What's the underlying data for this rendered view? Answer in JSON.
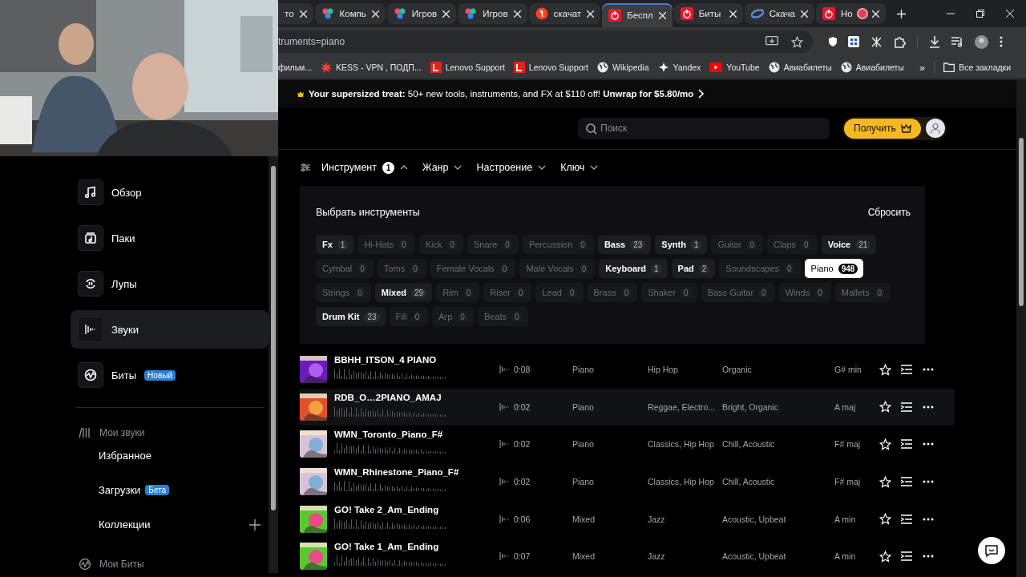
{
  "browser": {
    "tabs": [
      {
        "title": "то",
        "selected": false,
        "recording": false
      },
      {
        "title": "Компь",
        "selected": false,
        "recording": false
      },
      {
        "title": "Игров",
        "selected": false,
        "recording": false
      },
      {
        "title": "Игров",
        "selected": false,
        "recording": false
      },
      {
        "title": "скачат",
        "selected": false,
        "recording": false
      },
      {
        "title": "Беспл",
        "selected": true,
        "recording": false
      },
      {
        "title": "Биты",
        "selected": false,
        "recording": false
      },
      {
        "title": "Скача",
        "selected": false,
        "recording": false
      },
      {
        "title": "Но",
        "selected": false,
        "recording": true
      }
    ],
    "address": "truments=piano",
    "bookmarks": [
      {
        "label": "фильм..."
      },
      {
        "label": "KESS - VPN , ПОДП..."
      },
      {
        "label": "Lenovo Support"
      },
      {
        "label": "Lenovo Support"
      },
      {
        "label": "Wikipedia"
      },
      {
        "label": "Yandex"
      },
      {
        "label": "YouTube"
      },
      {
        "label": "Авиабилеты"
      },
      {
        "label": "Авиабилеты"
      }
    ],
    "more_bookmarks": "»",
    "all_bookmarks": "Все закладки"
  },
  "banner": {
    "text": "**Your supersized treat:** 50+ new tools, instruments, and FX at $110 off! **Unwrap for $5.80/mo**"
  },
  "header": {
    "search": {
      "placeholder": "Поиск"
    },
    "get_button": "Получить"
  },
  "filters": [
    {
      "label": "Инструмент",
      "badge": "1",
      "expanded": true
    },
    {
      "label": "Жанр",
      "expanded": false
    },
    {
      "label": "Настроение",
      "expanded": false
    },
    {
      "label": "Ключ",
      "expanded": false
    }
  ],
  "instrument_panel": {
    "title": "Выбрать инструменты",
    "reset": "Сбросить",
    "chips": [
      {
        "label": "Fx",
        "count": "1",
        "disabled": false,
        "selected": false
      },
      {
        "label": "Hi-Hats",
        "count": "0",
        "disabled": true,
        "selected": false
      },
      {
        "label": "Kick",
        "count": "0",
        "disabled": true,
        "selected": false
      },
      {
        "label": "Snare",
        "count": "0",
        "disabled": true,
        "selected": false
      },
      {
        "label": "Percussion",
        "count": "0",
        "disabled": true,
        "selected": false
      },
      {
        "label": "Bass",
        "count": "23",
        "disabled": false,
        "selected": false
      },
      {
        "label": "Synth",
        "count": "1",
        "disabled": false,
        "selected": false
      },
      {
        "label": "Guitar",
        "count": "0",
        "disabled": true,
        "selected": false
      },
      {
        "label": "Claps",
        "count": "0",
        "disabled": true,
        "selected": false
      },
      {
        "label": "Voice",
        "count": "21",
        "disabled": false,
        "selected": false
      },
      {
        "label": "Cymbal",
        "count": "0",
        "disabled": true,
        "selected": false
      },
      {
        "label": "Toms",
        "count": "0",
        "disabled": true,
        "selected": false
      },
      {
        "label": "Female Vocals",
        "count": "0",
        "disabled": true,
        "selected": false
      },
      {
        "label": "Male Vocals",
        "count": "0",
        "disabled": true,
        "selected": false
      },
      {
        "label": "Keyboard",
        "count": "1",
        "disabled": false,
        "selected": false
      },
      {
        "label": "Pad",
        "count": "2",
        "disabled": false,
        "selected": false
      },
      {
        "label": "Soundscapes",
        "count": "0",
        "disabled": true,
        "selected": false
      },
      {
        "label": "Piano",
        "count": "948",
        "disabled": false,
        "selected": true
      },
      {
        "label": "Strings",
        "count": "0",
        "disabled": true,
        "selected": false
      },
      {
        "label": "Mixed",
        "count": "29",
        "disabled": false,
        "selected": false
      },
      {
        "label": "Rim",
        "count": "0",
        "disabled": true,
        "selected": false
      },
      {
        "label": "Riser",
        "count": "0",
        "disabled": true,
        "selected": false
      },
      {
        "label": "Lead",
        "count": "0",
        "disabled": true,
        "selected": false
      },
      {
        "label": "Brass",
        "count": "0",
        "disabled": true,
        "selected": false
      },
      {
        "label": "Shaker",
        "count": "0",
        "disabled": true,
        "selected": false
      },
      {
        "label": "Bass Guitar",
        "count": "0",
        "disabled": true,
        "selected": false
      },
      {
        "label": "Winds",
        "count": "0",
        "disabled": true,
        "selected": false
      },
      {
        "label": "Mallets",
        "count": "0",
        "disabled": true,
        "selected": false
      },
      {
        "label": "Drum Kit",
        "count": "23",
        "disabled": false,
        "selected": false
      },
      {
        "label": "Fill",
        "count": "0",
        "disabled": true,
        "selected": false
      },
      {
        "label": "Arp",
        "count": "0",
        "disabled": true,
        "selected": false
      },
      {
        "label": "Beats",
        "count": "0",
        "disabled": true,
        "selected": false
      }
    ]
  },
  "rows": [
    {
      "name": "BBHH_ITSON_4 PIANO",
      "duration": "0:08",
      "instrument": "Piano",
      "genre": "Hip Hop",
      "mood": "Organic",
      "key": "G# min",
      "highlighted": false
    },
    {
      "name": "RDB_O…2PIANO_AMAJ",
      "duration": "0:02",
      "instrument": "Piano",
      "genre": "Reggae, Electro...",
      "mood": "Bright, Organic",
      "key": "A maj",
      "highlighted": true
    },
    {
      "name": "WMN_Toronto_Piano_F#",
      "duration": "0:02",
      "instrument": "Piano",
      "genre": "Classics, Hip Hop",
      "mood": "Chill, Acoustic",
      "key": "F# maj",
      "highlighted": false
    },
    {
      "name": "WMN_Rhinestone_Piano_F#",
      "duration": "0:02",
      "instrument": "Piano",
      "genre": "Classics, Hip Hop",
      "mood": "Chill, Acoustic",
      "key": "F# maj",
      "highlighted": false
    },
    {
      "name": "GO! Take 2_Am_Ending",
      "duration": "0:06",
      "instrument": "Mixed",
      "genre": "Jazz",
      "mood": "Acoustic, Upbeat",
      "key": "A min",
      "highlighted": false
    },
    {
      "name": "GO! Take 1_Am_Ending",
      "duration": "0:07",
      "instrument": "Mixed",
      "genre": "Jazz",
      "mood": "Acoustic, Upbeat",
      "key": "A min",
      "highlighted": false
    }
  ],
  "sidebar": {
    "nav": [
      {
        "label": "Обзор",
        "selected": false
      },
      {
        "label": "Паки",
        "selected": false
      },
      {
        "label": "Лупы",
        "selected": false
      },
      {
        "label": "Звуки",
        "selected": true
      },
      {
        "label": "Биты",
        "selected": false,
        "badge": "Новый"
      }
    ],
    "my_sounds": {
      "title": "Мои звуки",
      "items": [
        {
          "label": "Избранное",
          "addable": false
        },
        {
          "label": "Загрузки",
          "badge": "Бета",
          "addable": false
        },
        {
          "label": "Коллекции",
          "addable": true
        }
      ]
    },
    "my_beats": "Мои Биты"
  }
}
